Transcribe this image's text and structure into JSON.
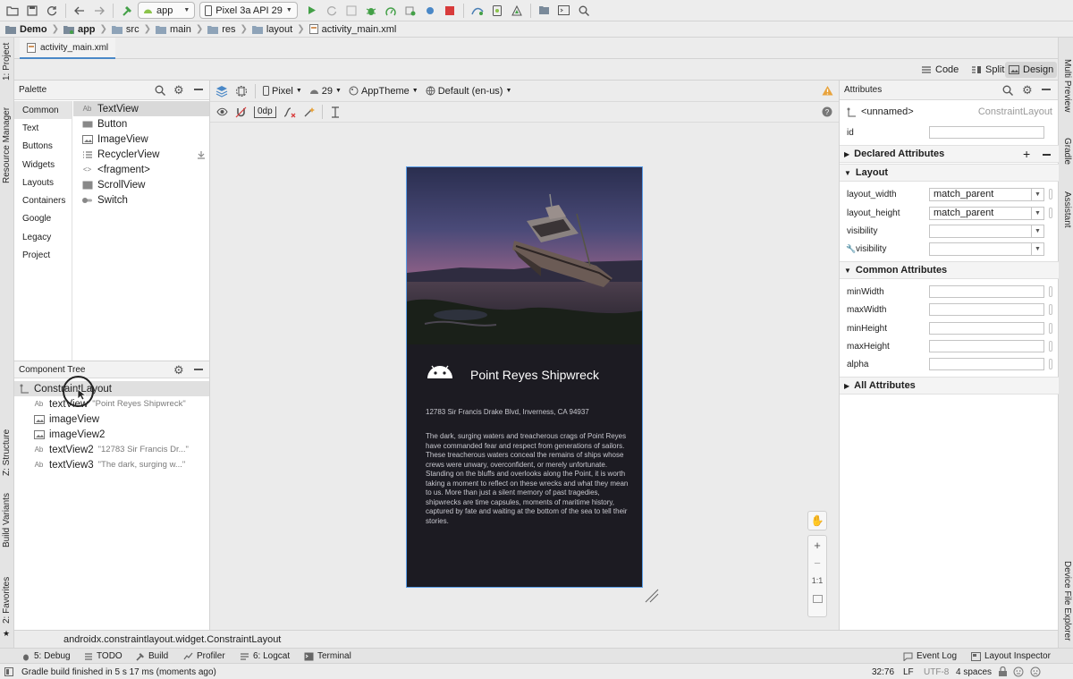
{
  "toolbar": {
    "run_config": "app",
    "device": "Pixel 3a API 29"
  },
  "breadcrumb": [
    "Demo",
    "app",
    "src",
    "main",
    "res",
    "layout",
    "activity_main.xml"
  ],
  "editor_tab": "activity_main.xml",
  "view_modes": {
    "code": "Code",
    "split": "Split",
    "design": "Design",
    "selected": "Design"
  },
  "left_strip": {
    "project": "1: Project",
    "resource_manager": "Resource Manager",
    "structure": "Z: Structure",
    "build_variants": "Build Variants",
    "favorites": "2: Favorites"
  },
  "right_strip": {
    "multi_preview": "Multi Preview",
    "gradle": "Gradle",
    "assistant": "Assistant",
    "device_file_explorer": "Device File Explorer"
  },
  "palette": {
    "title": "Palette",
    "categories": [
      "Common",
      "Text",
      "Buttons",
      "Widgets",
      "Layouts",
      "Containers",
      "Google",
      "Legacy",
      "Project"
    ],
    "selected_category": "Common",
    "items": [
      {
        "prefix": "Ab",
        "label": "TextView",
        "icon": "textview-icon"
      },
      {
        "prefix": "",
        "label": "Button",
        "icon": "button-icon"
      },
      {
        "prefix": "",
        "label": "ImageView",
        "icon": "image-icon"
      },
      {
        "prefix": "",
        "label": "RecyclerView",
        "icon": "list-icon"
      },
      {
        "prefix": "<>",
        "label": "<fragment>",
        "icon": "fragment-icon"
      },
      {
        "prefix": "",
        "label": "ScrollView",
        "icon": "scroll-icon"
      },
      {
        "prefix": "",
        "label": "Switch",
        "icon": "switch-icon"
      }
    ]
  },
  "component_tree": {
    "title": "Component Tree",
    "root": "ConstraintLayout",
    "children": [
      {
        "prefix": "Ab",
        "name": "textView",
        "detail": "\"Point Reyes Shipwreck\""
      },
      {
        "prefix": "",
        "name": "imageView",
        "detail": ""
      },
      {
        "prefix": "",
        "name": "imageView2",
        "detail": ""
      },
      {
        "prefix": "Ab",
        "name": "textView2",
        "detail": "\"12783 Sir Francis Dr...\""
      },
      {
        "prefix": "Ab",
        "name": "textView3",
        "detail": "\"The dark, surging w...\""
      }
    ]
  },
  "design_toolbar": {
    "device": "Pixel",
    "api": "29",
    "theme": "AppTheme",
    "locale": "Default (en-us)",
    "margin": "0dp"
  },
  "preview": {
    "title": "Point Reyes Shipwreck",
    "address": "12783 Sir Francis Drake Blvd, Inverness, CA 94937",
    "body": "The dark, surging waters and treacherous crags of Point Reyes have commanded fear and respect from generations of sailors. These treacherous waters conceal the remains of ships whose crews were unwary, overconfident, or merely unfortunate. Standing on the bluffs and overlooks along the Point, it is worth taking a moment to reflect on these wrecks and what they mean to us. More than just a silent memory of past tragedies, shipwrecks are time capsules, moments of maritime history, captured by fate and waiting at the bottom of the sea to tell their stories."
  },
  "zoom": {
    "reset": "1:1"
  },
  "attributes": {
    "title": "Attributes",
    "component_id": "<unnamed>",
    "component_type": "ConstraintLayout",
    "id_label": "id",
    "id_value": "",
    "declared": "Declared Attributes",
    "layout_section": "Layout",
    "layout_width_label": "layout_width",
    "layout_width_value": "match_parent",
    "layout_height_label": "layout_height",
    "layout_height_value": "match_parent",
    "visibility_label": "visibility",
    "tools_visibility_label": "visibility",
    "common_section": "Common Attributes",
    "min_width": "minWidth",
    "max_width": "maxWidth",
    "min_height": "minHeight",
    "max_height": "maxHeight",
    "alpha": "alpha",
    "all_section": "All Attributes"
  },
  "class_path": "androidx.constraintlayout.widget.ConstraintLayout",
  "tool_windows": {
    "debug": "5: Debug",
    "todo": "TODO",
    "build": "Build",
    "profiler": "Profiler",
    "logcat": "6: Logcat",
    "terminal": "Terminal",
    "event_log": "Event Log",
    "layout_inspector": "Layout Inspector"
  },
  "status_bar": {
    "message": "Gradle build finished in 5 s 17 ms (moments ago)",
    "position": "32:76",
    "line_sep": "LF",
    "encoding": "UTF-8",
    "indent": "4 spaces"
  },
  "colors": {
    "accent": "#4a88c7",
    "run_green": "#43a047",
    "stop_red": "#d83b3b",
    "android_green": "#8bc34a",
    "preview_bg": "#1c1b22"
  }
}
